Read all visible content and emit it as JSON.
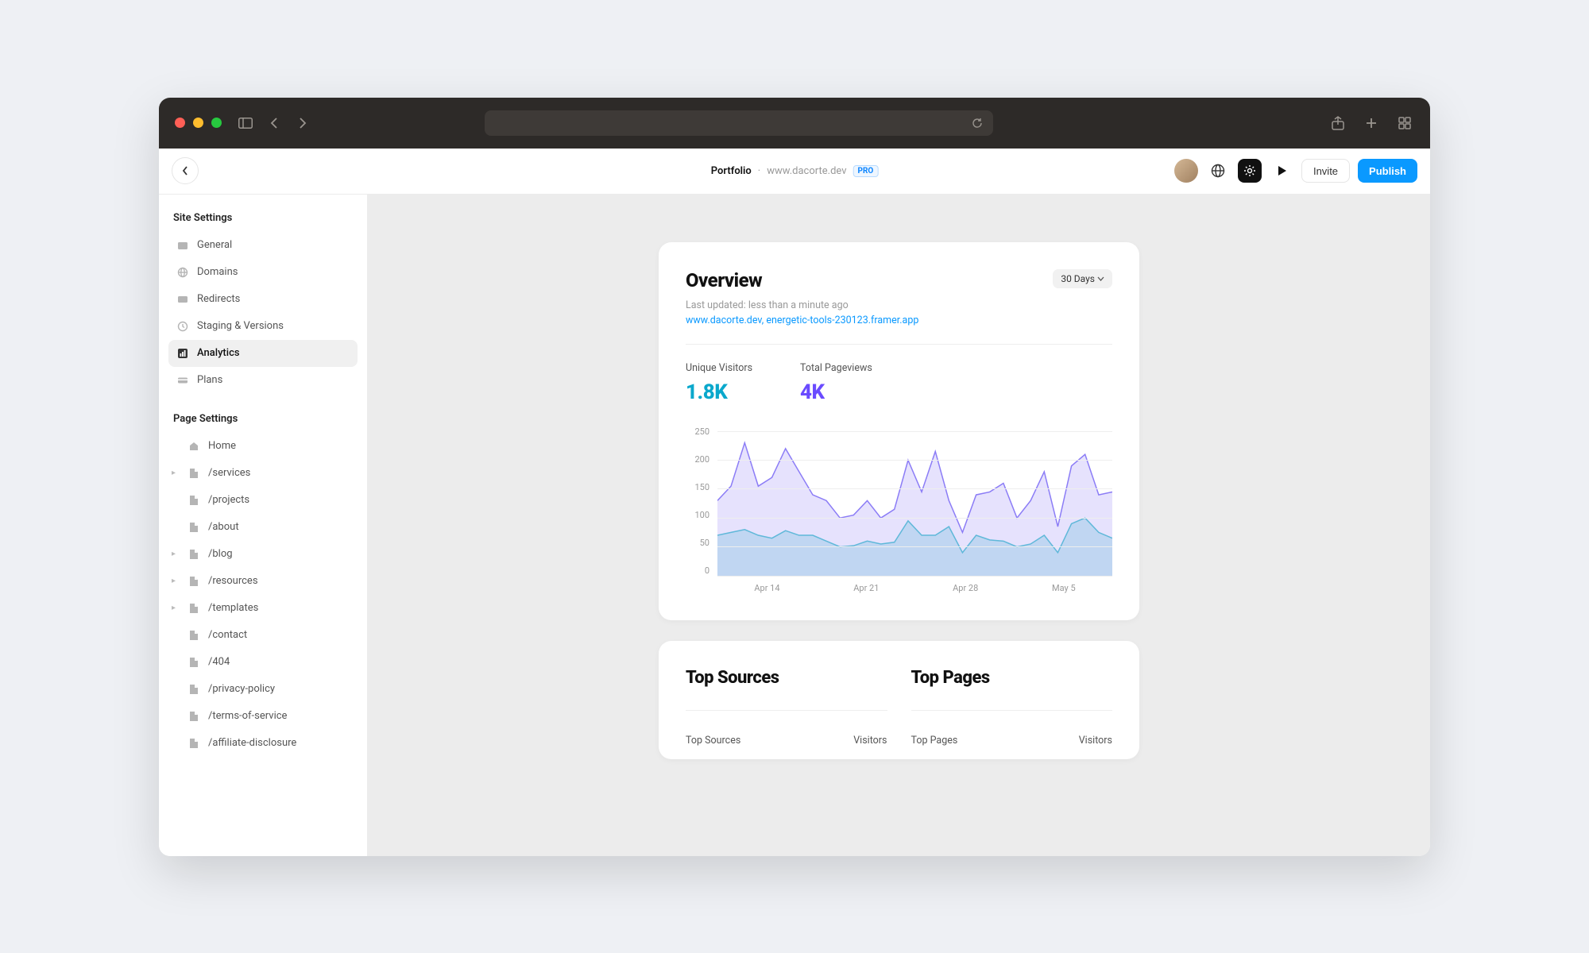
{
  "app_header": {
    "title": "Portfolio",
    "domain": "www.dacorte.dev",
    "plan_badge": "PRO",
    "invite_label": "Invite",
    "publish_label": "Publish"
  },
  "sidebar": {
    "site_settings_title": "Site Settings",
    "page_settings_title": "Page Settings",
    "site_items": [
      {
        "label": "General",
        "icon": "general-icon",
        "active": false
      },
      {
        "label": "Domains",
        "icon": "globe-icon",
        "active": false
      },
      {
        "label": "Redirects",
        "icon": "redirect-icon",
        "active": false
      },
      {
        "label": "Staging & Versions",
        "icon": "clock-icon",
        "active": false
      },
      {
        "label": "Analytics",
        "icon": "chart-icon",
        "active": true
      },
      {
        "label": "Plans",
        "icon": "card-icon",
        "active": false
      }
    ],
    "page_items": [
      {
        "label": "Home",
        "icon": "home-icon",
        "expandable": false
      },
      {
        "label": "/services",
        "icon": "page-icon",
        "expandable": true
      },
      {
        "label": "/projects",
        "icon": "page-icon",
        "expandable": false
      },
      {
        "label": "/about",
        "icon": "page-icon",
        "expandable": false
      },
      {
        "label": "/blog",
        "icon": "page-icon",
        "expandable": true
      },
      {
        "label": "/resources",
        "icon": "page-icon",
        "expandable": true
      },
      {
        "label": "/templates",
        "icon": "page-icon",
        "expandable": true
      },
      {
        "label": "/contact",
        "icon": "page-icon",
        "expandable": false
      },
      {
        "label": "/404",
        "icon": "page-icon",
        "expandable": false
      },
      {
        "label": "/privacy-policy",
        "icon": "page-icon",
        "expandable": false
      },
      {
        "label": "/terms-of-service",
        "icon": "page-icon",
        "expandable": false
      },
      {
        "label": "/affiliate-disclosure",
        "icon": "page-icon",
        "expandable": false
      }
    ]
  },
  "overview": {
    "title": "Overview",
    "range_label": "30 Days",
    "last_updated": "Last updated: less than a minute ago",
    "links_prefix": "www.dacorte.dev",
    "links_sep": ", ",
    "links_suffix": "energetic-tools-230123.framer.app",
    "stats": {
      "visitors_label": "Unique Visitors",
      "visitors_value": "1.8K",
      "pageviews_label": "Total Pageviews",
      "pageviews_value": "4K"
    }
  },
  "top_sources": {
    "title": "Top Sources",
    "col1": "Top Sources",
    "col2": "Visitors"
  },
  "top_pages": {
    "title": "Top Pages",
    "col1": "Top Pages",
    "col2": "Visitors"
  },
  "chart_data": {
    "type": "area",
    "xlabel": "",
    "ylabel": "",
    "ylim": [
      0,
      250
    ],
    "yticks": [
      0,
      50,
      100,
      150,
      200,
      250
    ],
    "x_ticks": [
      "Apr 14",
      "Apr 21",
      "Apr 28",
      "May 5"
    ],
    "series": [
      {
        "name": "Total Pageviews",
        "color": "#8b7cf6",
        "values": [
          130,
          155,
          230,
          155,
          170,
          220,
          180,
          140,
          130,
          100,
          105,
          130,
          100,
          115,
          200,
          145,
          215,
          130,
          75,
          140,
          145,
          160,
          100,
          130,
          180,
          85,
          190,
          210,
          140,
          145
        ]
      },
      {
        "name": "Unique Visitors",
        "color": "#5fb8d9",
        "values": [
          70,
          75,
          80,
          70,
          65,
          78,
          70,
          70,
          60,
          50,
          52,
          60,
          55,
          58,
          95,
          70,
          70,
          85,
          40,
          70,
          62,
          60,
          50,
          55,
          70,
          40,
          90,
          100,
          75,
          65
        ]
      }
    ]
  }
}
